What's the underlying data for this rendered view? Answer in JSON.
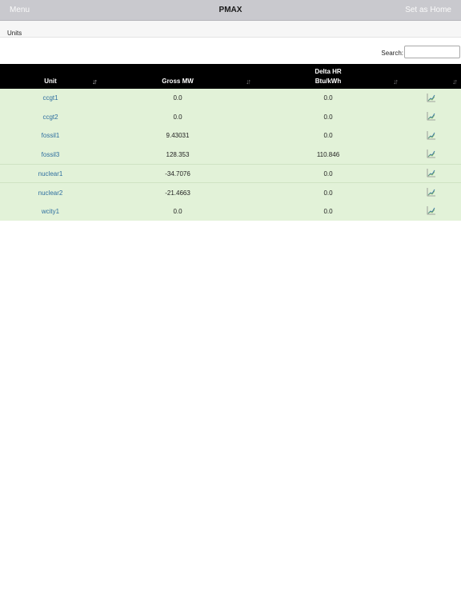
{
  "app": {
    "menu_label": "Menu",
    "title": "PMAX",
    "home_label": "Set as Home"
  },
  "breadcrumb": {
    "label": "Units"
  },
  "search": {
    "label": "Search:",
    "value": "",
    "placeholder": ""
  },
  "table": {
    "headers": {
      "unit": "Unit",
      "gross_mw": "Gross MW",
      "delta_hr_line1": "Delta HR",
      "delta_hr_line2": "Btu/kWh"
    },
    "rows": [
      {
        "unit": "ccgt1",
        "gross_mw": "0.0",
        "delta_hr": "0.0"
      },
      {
        "unit": "ccgt2",
        "gross_mw": "0.0",
        "delta_hr": "0.0"
      },
      {
        "unit": "fossil1",
        "gross_mw": "9.43031",
        "delta_hr": "0.0"
      },
      {
        "unit": "fossil3",
        "gross_mw": "128.353",
        "delta_hr": "110.846"
      },
      {
        "unit": "nuclear1",
        "gross_mw": "-34.7076",
        "delta_hr": "0.0"
      },
      {
        "unit": "nuclear2",
        "gross_mw": "-21.4663",
        "delta_hr": "0.0"
      },
      {
        "unit": "wcity1",
        "gross_mw": "0.0",
        "delta_hr": "0.0"
      }
    ]
  },
  "icons": {
    "row_action": "line-chart-icon",
    "sort": "sort-arrows-icon"
  },
  "colors": {
    "header_bg": "#000000",
    "row_bg": "#e2f2d8",
    "link": "#2f6fa0",
    "topbar": "#c9c9ce"
  }
}
